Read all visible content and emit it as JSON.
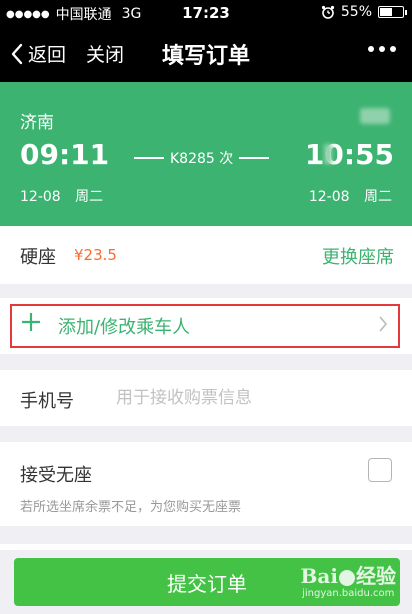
{
  "status_bar": {
    "signal_dots": "●●●●●",
    "carrier": "中国联通",
    "network": "3G",
    "time": "17:23",
    "alarm_icon": "alarm-icon",
    "battery": "55%",
    "battery_level": 0.55
  },
  "nav": {
    "back_label": "返回",
    "close_label": "关闭",
    "title": "填写订单"
  },
  "train": {
    "from_station": "济南",
    "depart_time": "09:11",
    "train_number": "K8285 次",
    "arrive_time": "10:55",
    "depart_date": "12-08",
    "depart_weekday": "周二",
    "arrive_date": "12-08",
    "arrive_weekday": "周二"
  },
  "seat": {
    "type": "硬座",
    "price": "¥23.5",
    "change_label": "更换座席"
  },
  "passenger": {
    "add_label": "添加/修改乘车人"
  },
  "phone": {
    "label": "手机号",
    "placeholder": "用于接收购票信息"
  },
  "no_seat": {
    "label": "接受无座",
    "description": "若所选坐席余票不足，为您购买无座票",
    "checked": false
  },
  "submit_label": "提交订单",
  "watermark": {
    "brand_left": "Bai",
    "brand_right": "经验",
    "site": "jingyan.baidu.com"
  },
  "colors": {
    "accent_green": "#3cb371",
    "button_green": "#44c245",
    "price_orange": "#ff6a2b",
    "highlight_red": "#e4393c"
  }
}
